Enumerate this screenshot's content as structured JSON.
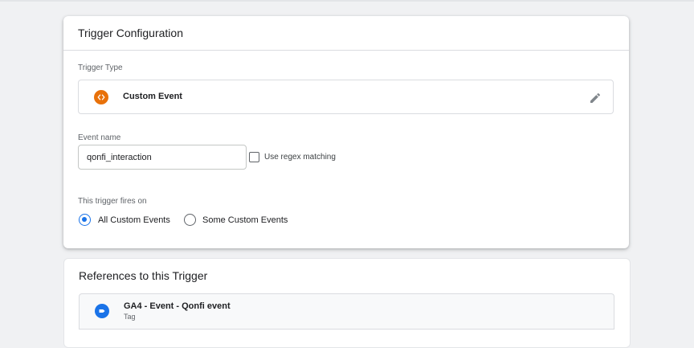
{
  "trigger_config": {
    "title": "Trigger Configuration",
    "trigger_type_label": "Trigger Type",
    "trigger_type_value": "Custom Event",
    "trigger_type_icon": "code-brackets-icon",
    "event_name_label": "Event name",
    "event_name_value": "qonfi_interaction",
    "regex_label": "Use regex matching",
    "regex_checked": false,
    "fires_on_label": "This trigger fires on",
    "fires_on_options": [
      {
        "label": "All Custom Events",
        "selected": true
      },
      {
        "label": "Some Custom Events",
        "selected": false
      }
    ]
  },
  "references": {
    "title": "References to this Trigger",
    "items": [
      {
        "name": "GA4 - Event - Qonfi event",
        "type": "Tag",
        "icon": "tag-icon"
      }
    ]
  },
  "colors": {
    "custom_event_icon": "#e8710a",
    "tag_icon": "#1a73e8",
    "radio_selected": "#1a73e8"
  }
}
